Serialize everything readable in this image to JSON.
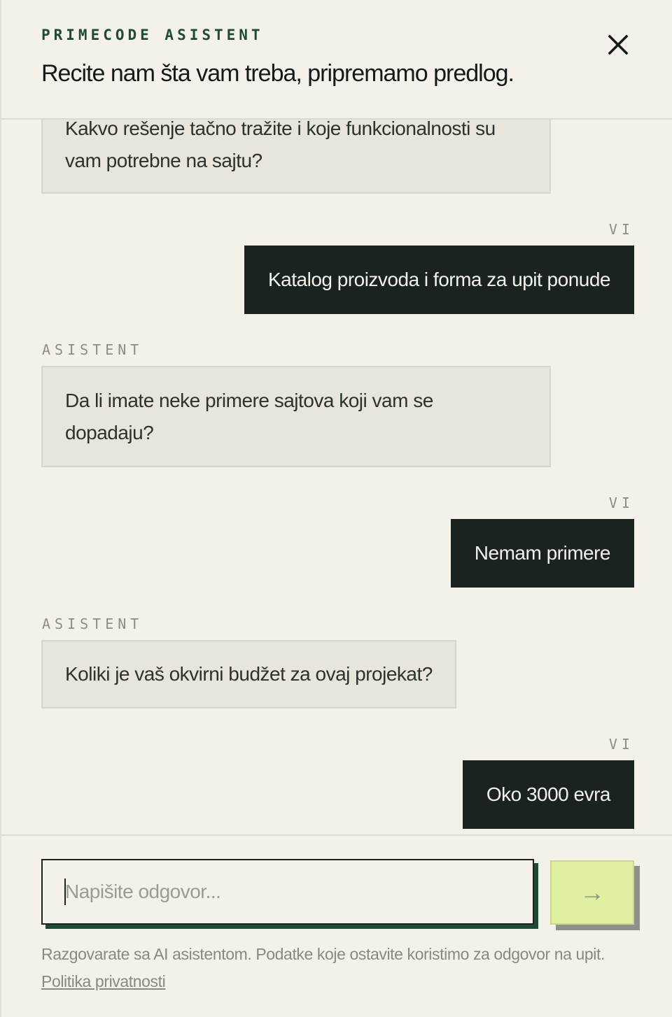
{
  "header": {
    "brand": "PRIMECODE ASISTENT",
    "headline": "Recite nam šta vam treba, pripremamo predlog.",
    "close_icon": "close-icon"
  },
  "messages": [
    {
      "role": "assistant",
      "label": "ASISTENT",
      "text_lines": [
        "Kakvo rešenje tačno tražite i koje funkcionalnosti su",
        "vam potrebne na sajtu?"
      ]
    },
    {
      "role": "user",
      "label": "VI",
      "text": "Katalog proizvoda i forma za upit ponude"
    },
    {
      "role": "assistant",
      "label": "ASISTENT",
      "text_lines": [
        "Da li imate neke primere sajtova koji vam se",
        "dopadaju?"
      ]
    },
    {
      "role": "user",
      "label": "VI",
      "text": "Nemam primere"
    },
    {
      "role": "assistant",
      "label": "ASISTENT",
      "text": "Koliki je vaš okvirni budžet za ovaj projekat?"
    },
    {
      "role": "user",
      "label": "VI",
      "text": "Oko 3000 evra"
    }
  ],
  "composer": {
    "placeholder": "Napišite odgovor...",
    "value": "",
    "send_icon": "arrow-right-icon",
    "send_glyph": "→",
    "disclaimer": "Razgovarate sa AI asistentom. Podatke koje ostavite koristimo za odgovor na upit.",
    "privacy_link": "Politika privatnosti"
  },
  "colors": {
    "background": "#f3f1ea",
    "brand_green": "#1f4a33",
    "user_bubble": "#1a231f",
    "assistant_bubble": "#e8e5da",
    "send_button": "#dff0a2"
  }
}
